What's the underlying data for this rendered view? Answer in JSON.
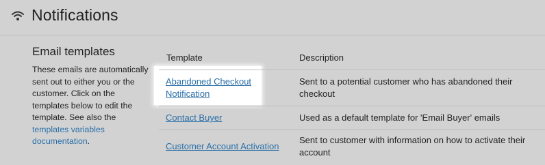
{
  "header": {
    "title": "Notifications",
    "icon": "wifi-icon"
  },
  "sidebar": {
    "heading": "Email templates",
    "description": "These emails are automatically sent out to either you or the customer. Click on the templates below to edit the template. See also the",
    "link_text": "templates variables documentation",
    "trailing": "."
  },
  "table": {
    "columns": [
      "Template",
      "Description"
    ],
    "rows": [
      {
        "template": "Abandoned Checkout Notification",
        "description": "Sent to a potential customer who has abandoned their checkout"
      },
      {
        "template": "Contact Buyer",
        "description": "Used as a default template for 'Email Buyer' emails"
      },
      {
        "template": "Customer Account Activation",
        "description": "Sent to customer with information on how to activate their account"
      }
    ]
  },
  "colors": {
    "background": "#d2d2d2",
    "link": "#2a6fa8",
    "highlight": "#ffffff"
  }
}
